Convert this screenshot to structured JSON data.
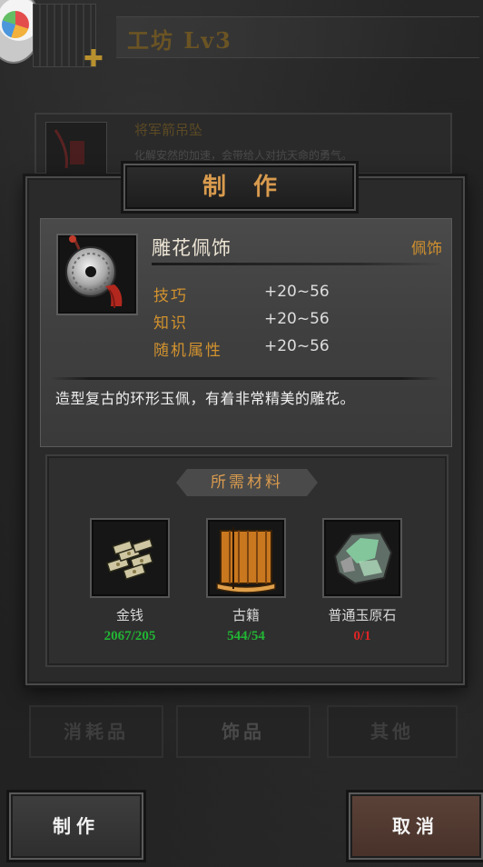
{
  "workshop": {
    "title": "工坊 Lv3"
  },
  "background_item": {
    "name": "将军箭吊坠",
    "desc": "化解安然的加速，会带给人对抗天命的勇气。"
  },
  "background_tabs": [
    "消耗品",
    "饰品",
    "其他"
  ],
  "modal": {
    "title": "制作",
    "item": {
      "name": "雕花佩饰",
      "category": "佩饰",
      "icon": "jade-ring-pendant-icon",
      "stats": [
        {
          "name": "技巧",
          "value": "+20~56"
        },
        {
          "name": "知识",
          "value": "+20~56"
        },
        {
          "name": "随机属性",
          "value": "+20~56"
        }
      ],
      "description": "造型复古的环形玉佩，有着非常精美的雕花。"
    },
    "materials": {
      "header": "所需材料",
      "items": [
        {
          "icon": "gold-money-icon",
          "name": "金钱",
          "count": "2067/205",
          "count_color": "#22b534"
        },
        {
          "icon": "ancient-scroll-icon",
          "name": "古籍",
          "count": "544/54",
          "count_color": "#22b534"
        },
        {
          "icon": "raw-jade-stone-icon",
          "name": "普通玉原石",
          "count": "0/1",
          "count_color": "#e02424"
        }
      ]
    }
  },
  "buttons": {
    "make": "制作",
    "cancel": "取消"
  },
  "colors": {
    "accent": "#d99b4e",
    "ok": "#22b534",
    "insufficient": "#e02424"
  }
}
